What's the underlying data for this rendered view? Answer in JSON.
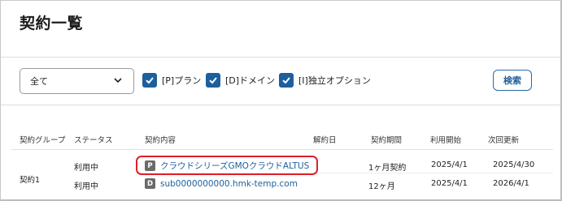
{
  "page": {
    "title": "契約一覧"
  },
  "filters": {
    "select_value": "全て",
    "checkboxes": [
      {
        "label": "[P]プラン",
        "checked": true
      },
      {
        "label": "[D]ドメイン",
        "checked": true
      },
      {
        "label": "[I]独立オプション",
        "checked": true
      }
    ],
    "search_label": "検索"
  },
  "table": {
    "headers": [
      "契約グループ",
      "ステータス",
      "契約内容",
      "解約日",
      "契約期間",
      "利用開始",
      "次回更新"
    ],
    "group": "契約1",
    "rows": [
      {
        "status": "利用中",
        "type_badge": "P",
        "content": "クラウドシリーズGMOクラウドALTUS",
        "cancel_date": "",
        "period": "1ヶ月契約",
        "start": "2025/4/1",
        "renewal": "2025/4/30"
      },
      {
        "status": "利用中",
        "type_badge": "D",
        "content": "sub0000000000.hmk-temp.com",
        "cancel_date": "",
        "period": "12ヶ月",
        "start": "2025/4/1",
        "renewal": "2026/4/1"
      }
    ]
  },
  "colors": {
    "accent": "#1d5f9c",
    "highlight": "#e0202a",
    "badge": "#6a6a6a"
  }
}
